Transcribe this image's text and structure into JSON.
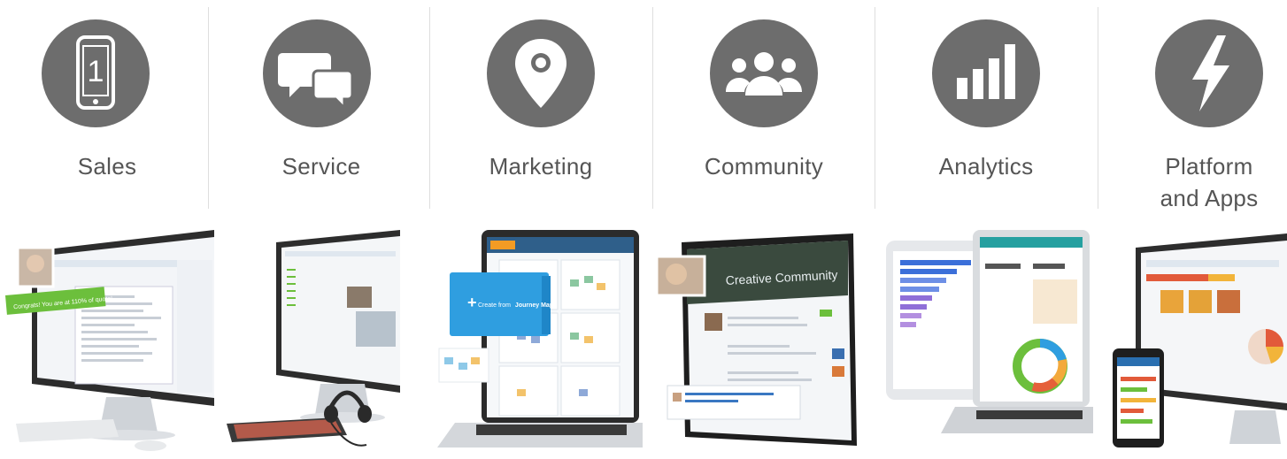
{
  "products": [
    {
      "id": "sales",
      "label": "Sales",
      "icon": "mobile-phone-icon",
      "glyph": "1",
      "badge_text": "Congrats! You are at 110% of quota!"
    },
    {
      "id": "service",
      "label": "Service",
      "icon": "chat-bubbles-icon"
    },
    {
      "id": "marketing",
      "label": "Marketing",
      "icon": "map-pin-icon",
      "cta_prefix": "Create from",
      "cta_bold": "Journey Map"
    },
    {
      "id": "community",
      "label": "Community",
      "icon": "people-group-icon",
      "banner_text": "Creative Community"
    },
    {
      "id": "analytics",
      "label": "Analytics",
      "icon": "bar-chart-icon"
    },
    {
      "id": "platform",
      "label": "Platform and Apps",
      "label_line1": "Platform",
      "label_line2": "and Apps",
      "icon": "lightning-bolt-icon"
    }
  ],
  "colors": {
    "icon_bg": "#6d6d6d",
    "label": "#555555",
    "sales_green": "#6cbf3c",
    "marketing_blue": "#2f9ee0",
    "divider": "#dedede"
  }
}
